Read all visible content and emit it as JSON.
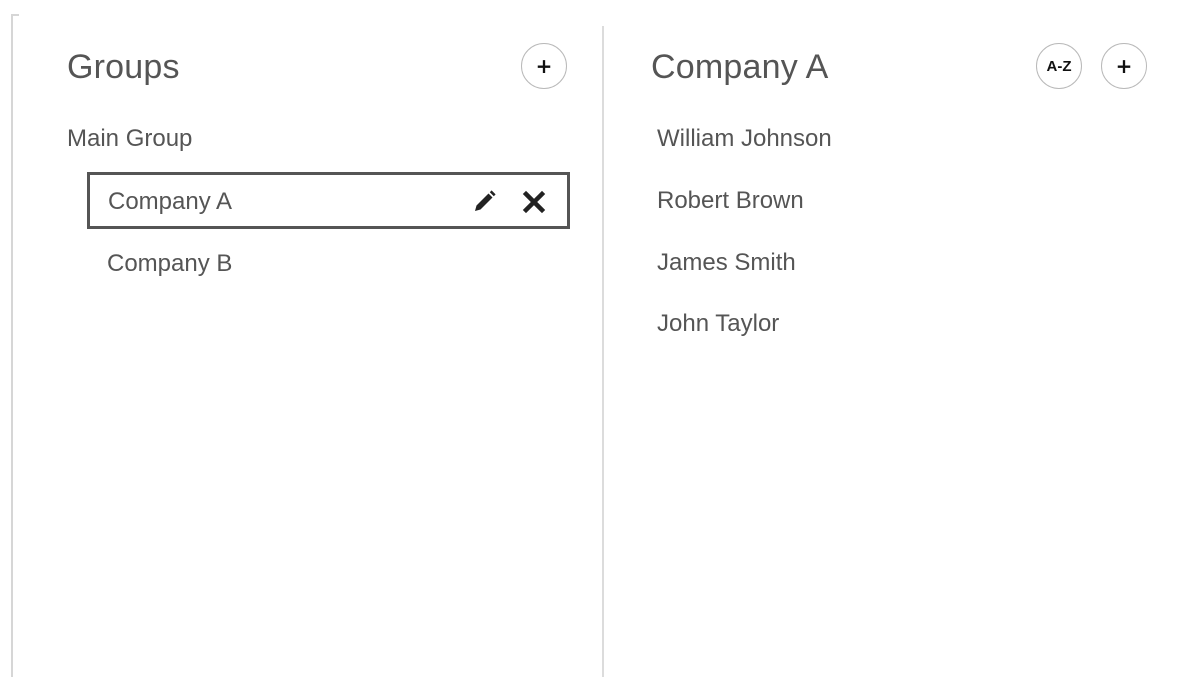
{
  "groups_panel": {
    "title": "Groups",
    "add_button_label": "+",
    "root_group": "Main Group",
    "selected_group": "Company A",
    "other_groups": [
      "Company B"
    ]
  },
  "members_panel": {
    "title": "Company A",
    "sort_button_label": "A-Z",
    "add_button_label": "+",
    "members": [
      "William Johnson",
      "Robert Brown",
      "James Smith",
      "John Taylor"
    ]
  },
  "icons": {
    "edit": "pencil-icon",
    "delete": "close-icon"
  },
  "colors": {
    "text": "#555555",
    "selected_border": "#555555",
    "button_border": "#b9b9b9",
    "divider": "#dcdcdc"
  }
}
